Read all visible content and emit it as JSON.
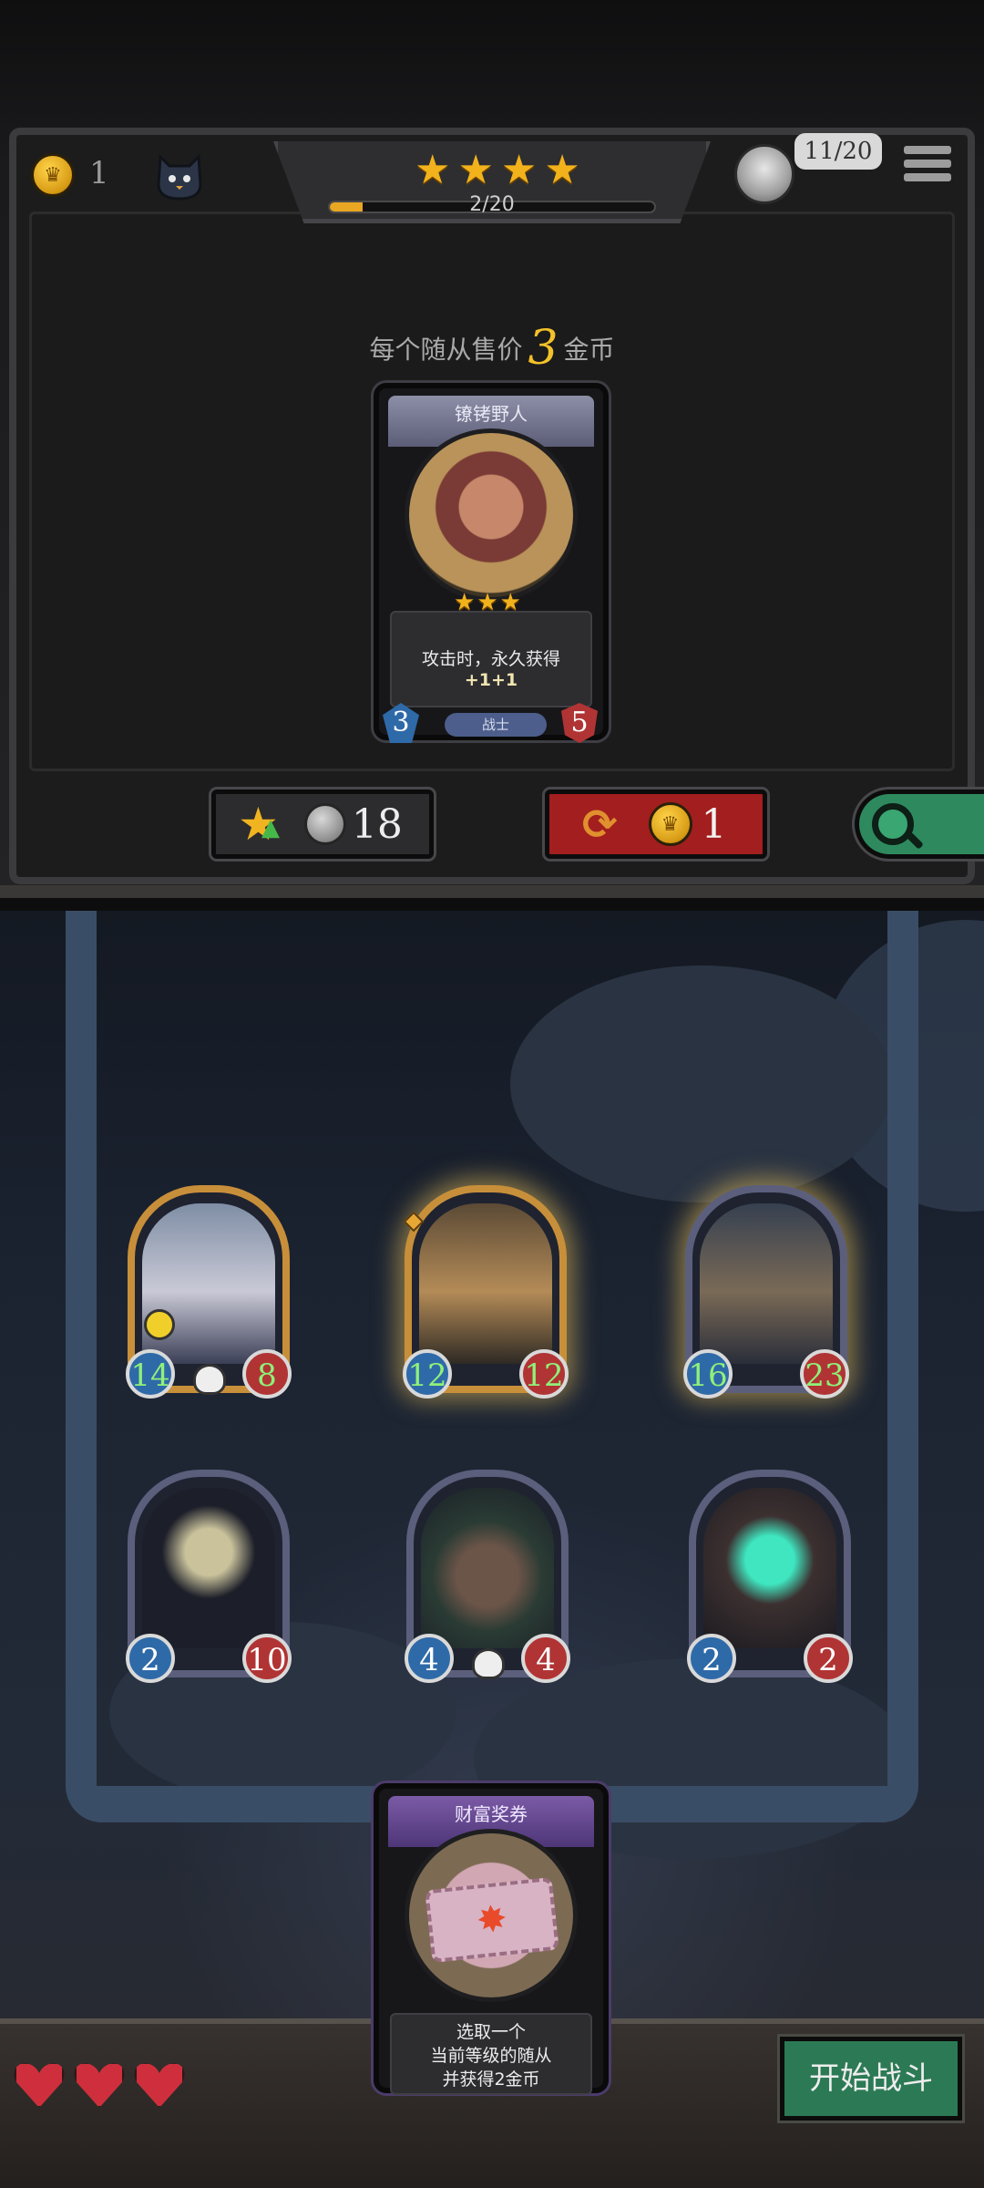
{
  "top_bar": {
    "gold": "1",
    "tier_stars": 4,
    "tier_progress_text": "2/20",
    "tier_progress": 0.1,
    "health": "11/20"
  },
  "shop": {
    "sell_prefix": "每个随从售价",
    "sell_price": "3",
    "sell_suffix": "金币",
    "card": {
      "name": "镣铐野人",
      "stars": 3,
      "description": "攻击时，永久获得",
      "buff": "+1+1",
      "attack": "3",
      "health": "5",
      "tribe": "战士"
    },
    "upgrade_cost": "18",
    "refresh_cost": "1"
  },
  "board": {
    "minions": [
      {
        "attack": "14",
        "health": "8",
        "frame": "gold",
        "buffed": true,
        "skull": true,
        "smile": true,
        "glow": false
      },
      {
        "attack": "12",
        "health": "12",
        "frame": "gold",
        "buffed": true,
        "skull": false,
        "smile": false,
        "glow": true
      },
      {
        "attack": "16",
        "health": "23",
        "frame": "silver",
        "buffed": true,
        "skull": false,
        "smile": false,
        "glow": true
      },
      {
        "attack": "2",
        "health": "10",
        "frame": "silver",
        "buffed": false,
        "skull": false,
        "smile": false,
        "glow": false
      },
      {
        "attack": "4",
        "health": "4",
        "frame": "silver",
        "buffed": false,
        "skull": true,
        "smile": false,
        "glow": false
      },
      {
        "attack": "2",
        "health": "2",
        "frame": "silver",
        "buffed": false,
        "skull": false,
        "smile": false,
        "glow": false
      }
    ]
  },
  "discover_card": {
    "name": "财富奖券",
    "line1": "选取一个",
    "line2": "当前等级的随从",
    "line3": "并获得2金币"
  },
  "lives": 3,
  "start_battle": "开始战斗",
  "colors": {
    "gold": "#f3c12a",
    "attack_blue": "#2f6aa8",
    "health_red": "#b13434",
    "buff_green": "#8ff07a",
    "refresh_red": "#a31e1e",
    "start_green": "#2c7a55"
  }
}
